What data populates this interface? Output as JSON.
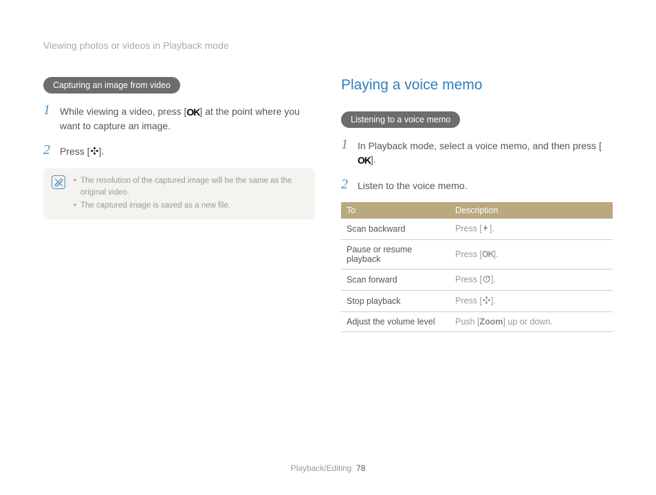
{
  "breadcrumb": "Viewing photos or videos in Playback mode",
  "left": {
    "pill": "Capturing an image from video",
    "steps": [
      {
        "num": "1",
        "pre": "While viewing a video, press [",
        "icon": "ok",
        "post": "] at the point where you want to capture an image."
      },
      {
        "num": "2",
        "pre": "Press [",
        "icon": "flower",
        "post": "]."
      }
    ],
    "notes": [
      "The resolution of the captured image will be the same as the original video.",
      "The captured image is saved as a new file."
    ]
  },
  "right": {
    "heading": "Playing a voice memo",
    "pill": "Listening to a voice memo",
    "steps": [
      {
        "num": "1",
        "pre": "In Playback mode, select a voice memo, and then press [",
        "icon": "ok",
        "post": "]."
      },
      {
        "num": "2",
        "pre": "Listen to the voice memo.",
        "icon": "",
        "post": ""
      }
    ],
    "table": {
      "head": {
        "to": "To",
        "desc": "Description"
      },
      "rows": [
        {
          "to": "Scan backward",
          "pre": "Press [",
          "icon": "flash",
          "post": "]."
        },
        {
          "to": "Pause or resume playback",
          "pre": "Press [",
          "icon": "ok-gray",
          "post": "]."
        },
        {
          "to": "Scan forward",
          "pre": "Press [",
          "icon": "timer",
          "post": "]."
        },
        {
          "to": "Stop playback",
          "pre": "Press [",
          "icon": "flower-gray",
          "post": "]."
        },
        {
          "to": "Adjust the volume level",
          "pre": "Push [",
          "icon": "zoom",
          "post": "] up or down."
        }
      ]
    }
  },
  "footer": {
    "section": "Playback/Editing",
    "page": "78"
  }
}
